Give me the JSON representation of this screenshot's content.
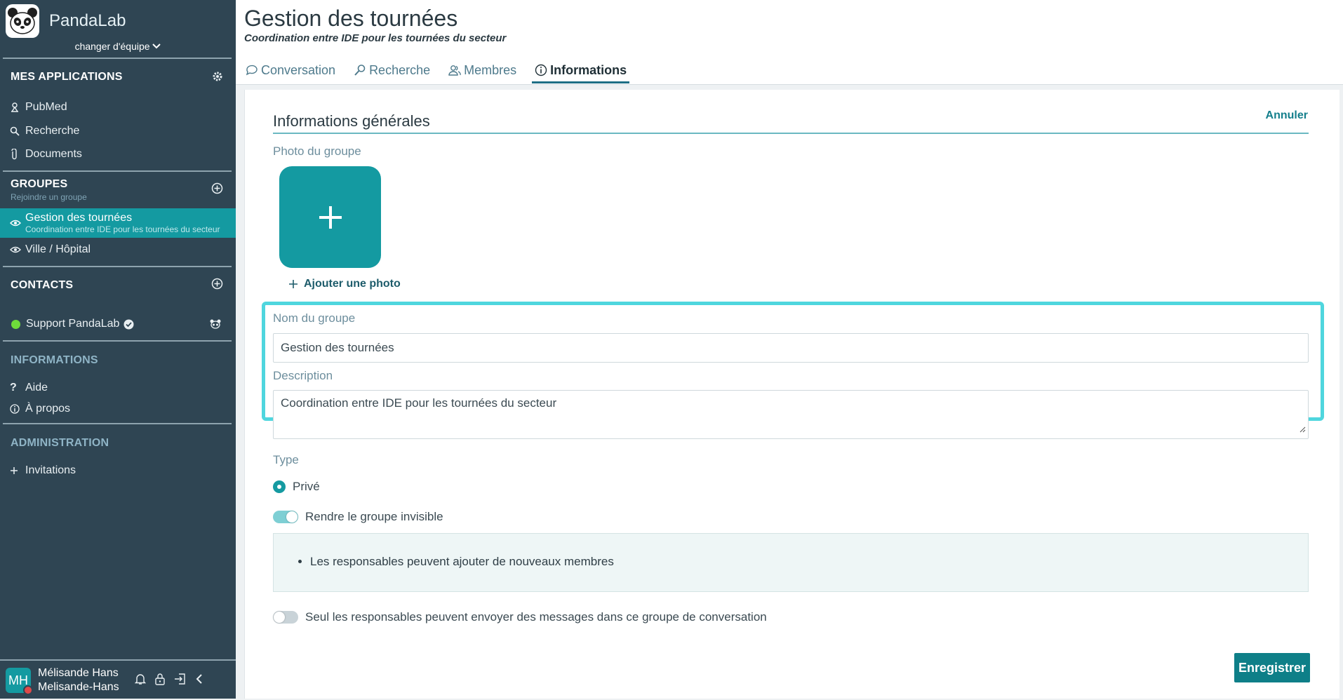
{
  "brand": {
    "name": "PandaLab"
  },
  "team_switch": {
    "label": "changer d'équipe"
  },
  "sidebar": {
    "apps": {
      "title": "MES APPLICATIONS",
      "items": [
        {
          "label": "PubMed",
          "icon": "pubmed-icon"
        },
        {
          "label": "Recherche",
          "icon": "search-icon"
        },
        {
          "label": "Documents",
          "icon": "paperclip-icon"
        }
      ]
    },
    "groups": {
      "title": "GROUPES",
      "subtitle": "Rejoindre un groupe",
      "items": [
        {
          "label": "Gestion des tournées",
          "sub": "Coordination entre IDE pour les tournées du secteur",
          "active": true
        },
        {
          "label": "Ville / Hôpital",
          "active": false
        }
      ]
    },
    "contacts": {
      "title": "CONTACTS",
      "items": [
        {
          "label": "Support PandaLab",
          "status": "online"
        }
      ]
    },
    "informations": {
      "title": "INFORMATIONS",
      "items": [
        {
          "label": "Aide",
          "icon": "question-icon"
        },
        {
          "label": "À propos",
          "icon": "info-icon"
        }
      ]
    },
    "administration": {
      "title": "ADMINISTRATION",
      "items": [
        {
          "label": "Invitations",
          "icon": "plus-icon"
        }
      ]
    }
  },
  "user": {
    "initials": "MH",
    "display_name": "Mélisande Hans",
    "username": "Melisande-Hans"
  },
  "header": {
    "title": "Gestion des tournées",
    "subtitle": "Coordination entre IDE pour les tournées du secteur",
    "tabs": [
      {
        "label": "Conversation",
        "icon": "chat-icon",
        "active": false
      },
      {
        "label": "Recherche",
        "icon": "search-icon",
        "active": false
      },
      {
        "label": "Membres",
        "icon": "members-icon",
        "active": false
      },
      {
        "label": "Informations",
        "icon": "info-icon",
        "active": true
      }
    ]
  },
  "form": {
    "heading": "Informations générales",
    "cancel_label": "Annuler",
    "photo_label": "Photo du groupe",
    "add_photo_label": "Ajouter une photo",
    "name_label": "Nom du groupe",
    "name_value": "Gestion des tournées",
    "description_label": "Description",
    "description_value": "Coordination entre IDE pour les tournées du secteur",
    "type_label": "Type",
    "type_value": "Privé",
    "invisible_label": "Rendre le groupe invisible",
    "invisible_on": true,
    "info_bullets": [
      "Les responsables peuvent ajouter de nouveaux membres"
    ],
    "only_managers_label": "Seul les responsables peuvent envoyer des messages dans ce groupe de conversation",
    "only_managers_on": false,
    "save_label": "Enregistrer"
  },
  "colors": {
    "accent": "#149aa1",
    "sidebar": "#2f4553",
    "highlight": "#4fd6de",
    "save": "#0e7f88"
  }
}
